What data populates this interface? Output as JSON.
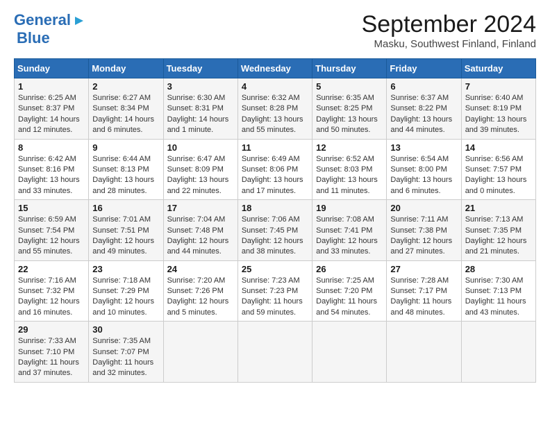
{
  "header": {
    "logo_line1": "General",
    "logo_line2": "Blue",
    "title": "September 2024",
    "subtitle": "Masku, Southwest Finland, Finland"
  },
  "days_of_week": [
    "Sunday",
    "Monday",
    "Tuesday",
    "Wednesday",
    "Thursday",
    "Friday",
    "Saturday"
  ],
  "weeks": [
    [
      {
        "day": "1",
        "sunrise": "Sunrise: 6:25 AM",
        "sunset": "Sunset: 8:37 PM",
        "daylight": "Daylight: 14 hours and 12 minutes."
      },
      {
        "day": "2",
        "sunrise": "Sunrise: 6:27 AM",
        "sunset": "Sunset: 8:34 PM",
        "daylight": "Daylight: 14 hours and 6 minutes."
      },
      {
        "day": "3",
        "sunrise": "Sunrise: 6:30 AM",
        "sunset": "Sunset: 8:31 PM",
        "daylight": "Daylight: 14 hours and 1 minute."
      },
      {
        "day": "4",
        "sunrise": "Sunrise: 6:32 AM",
        "sunset": "Sunset: 8:28 PM",
        "daylight": "Daylight: 13 hours and 55 minutes."
      },
      {
        "day": "5",
        "sunrise": "Sunrise: 6:35 AM",
        "sunset": "Sunset: 8:25 PM",
        "daylight": "Daylight: 13 hours and 50 minutes."
      },
      {
        "day": "6",
        "sunrise": "Sunrise: 6:37 AM",
        "sunset": "Sunset: 8:22 PM",
        "daylight": "Daylight: 13 hours and 44 minutes."
      },
      {
        "day": "7",
        "sunrise": "Sunrise: 6:40 AM",
        "sunset": "Sunset: 8:19 PM",
        "daylight": "Daylight: 13 hours and 39 minutes."
      }
    ],
    [
      {
        "day": "8",
        "sunrise": "Sunrise: 6:42 AM",
        "sunset": "Sunset: 8:16 PM",
        "daylight": "Daylight: 13 hours and 33 minutes."
      },
      {
        "day": "9",
        "sunrise": "Sunrise: 6:44 AM",
        "sunset": "Sunset: 8:13 PM",
        "daylight": "Daylight: 13 hours and 28 minutes."
      },
      {
        "day": "10",
        "sunrise": "Sunrise: 6:47 AM",
        "sunset": "Sunset: 8:09 PM",
        "daylight": "Daylight: 13 hours and 22 minutes."
      },
      {
        "day": "11",
        "sunrise": "Sunrise: 6:49 AM",
        "sunset": "Sunset: 8:06 PM",
        "daylight": "Daylight: 13 hours and 17 minutes."
      },
      {
        "day": "12",
        "sunrise": "Sunrise: 6:52 AM",
        "sunset": "Sunset: 8:03 PM",
        "daylight": "Daylight: 13 hours and 11 minutes."
      },
      {
        "day": "13",
        "sunrise": "Sunrise: 6:54 AM",
        "sunset": "Sunset: 8:00 PM",
        "daylight": "Daylight: 13 hours and 6 minutes."
      },
      {
        "day": "14",
        "sunrise": "Sunrise: 6:56 AM",
        "sunset": "Sunset: 7:57 PM",
        "daylight": "Daylight: 13 hours and 0 minutes."
      }
    ],
    [
      {
        "day": "15",
        "sunrise": "Sunrise: 6:59 AM",
        "sunset": "Sunset: 7:54 PM",
        "daylight": "Daylight: 12 hours and 55 minutes."
      },
      {
        "day": "16",
        "sunrise": "Sunrise: 7:01 AM",
        "sunset": "Sunset: 7:51 PM",
        "daylight": "Daylight: 12 hours and 49 minutes."
      },
      {
        "day": "17",
        "sunrise": "Sunrise: 7:04 AM",
        "sunset": "Sunset: 7:48 PM",
        "daylight": "Daylight: 12 hours and 44 minutes."
      },
      {
        "day": "18",
        "sunrise": "Sunrise: 7:06 AM",
        "sunset": "Sunset: 7:45 PM",
        "daylight": "Daylight: 12 hours and 38 minutes."
      },
      {
        "day": "19",
        "sunrise": "Sunrise: 7:08 AM",
        "sunset": "Sunset: 7:41 PM",
        "daylight": "Daylight: 12 hours and 33 minutes."
      },
      {
        "day": "20",
        "sunrise": "Sunrise: 7:11 AM",
        "sunset": "Sunset: 7:38 PM",
        "daylight": "Daylight: 12 hours and 27 minutes."
      },
      {
        "day": "21",
        "sunrise": "Sunrise: 7:13 AM",
        "sunset": "Sunset: 7:35 PM",
        "daylight": "Daylight: 12 hours and 21 minutes."
      }
    ],
    [
      {
        "day": "22",
        "sunrise": "Sunrise: 7:16 AM",
        "sunset": "Sunset: 7:32 PM",
        "daylight": "Daylight: 12 hours and 16 minutes."
      },
      {
        "day": "23",
        "sunrise": "Sunrise: 7:18 AM",
        "sunset": "Sunset: 7:29 PM",
        "daylight": "Daylight: 12 hours and 10 minutes."
      },
      {
        "day": "24",
        "sunrise": "Sunrise: 7:20 AM",
        "sunset": "Sunset: 7:26 PM",
        "daylight": "Daylight: 12 hours and 5 minutes."
      },
      {
        "day": "25",
        "sunrise": "Sunrise: 7:23 AM",
        "sunset": "Sunset: 7:23 PM",
        "daylight": "Daylight: 11 hours and 59 minutes."
      },
      {
        "day": "26",
        "sunrise": "Sunrise: 7:25 AM",
        "sunset": "Sunset: 7:20 PM",
        "daylight": "Daylight: 11 hours and 54 minutes."
      },
      {
        "day": "27",
        "sunrise": "Sunrise: 7:28 AM",
        "sunset": "Sunset: 7:17 PM",
        "daylight": "Daylight: 11 hours and 48 minutes."
      },
      {
        "day": "28",
        "sunrise": "Sunrise: 7:30 AM",
        "sunset": "Sunset: 7:13 PM",
        "daylight": "Daylight: 11 hours and 43 minutes."
      }
    ],
    [
      {
        "day": "29",
        "sunrise": "Sunrise: 7:33 AM",
        "sunset": "Sunset: 7:10 PM",
        "daylight": "Daylight: 11 hours and 37 minutes."
      },
      {
        "day": "30",
        "sunrise": "Sunrise: 7:35 AM",
        "sunset": "Sunset: 7:07 PM",
        "daylight": "Daylight: 11 hours and 32 minutes."
      },
      null,
      null,
      null,
      null,
      null
    ]
  ]
}
